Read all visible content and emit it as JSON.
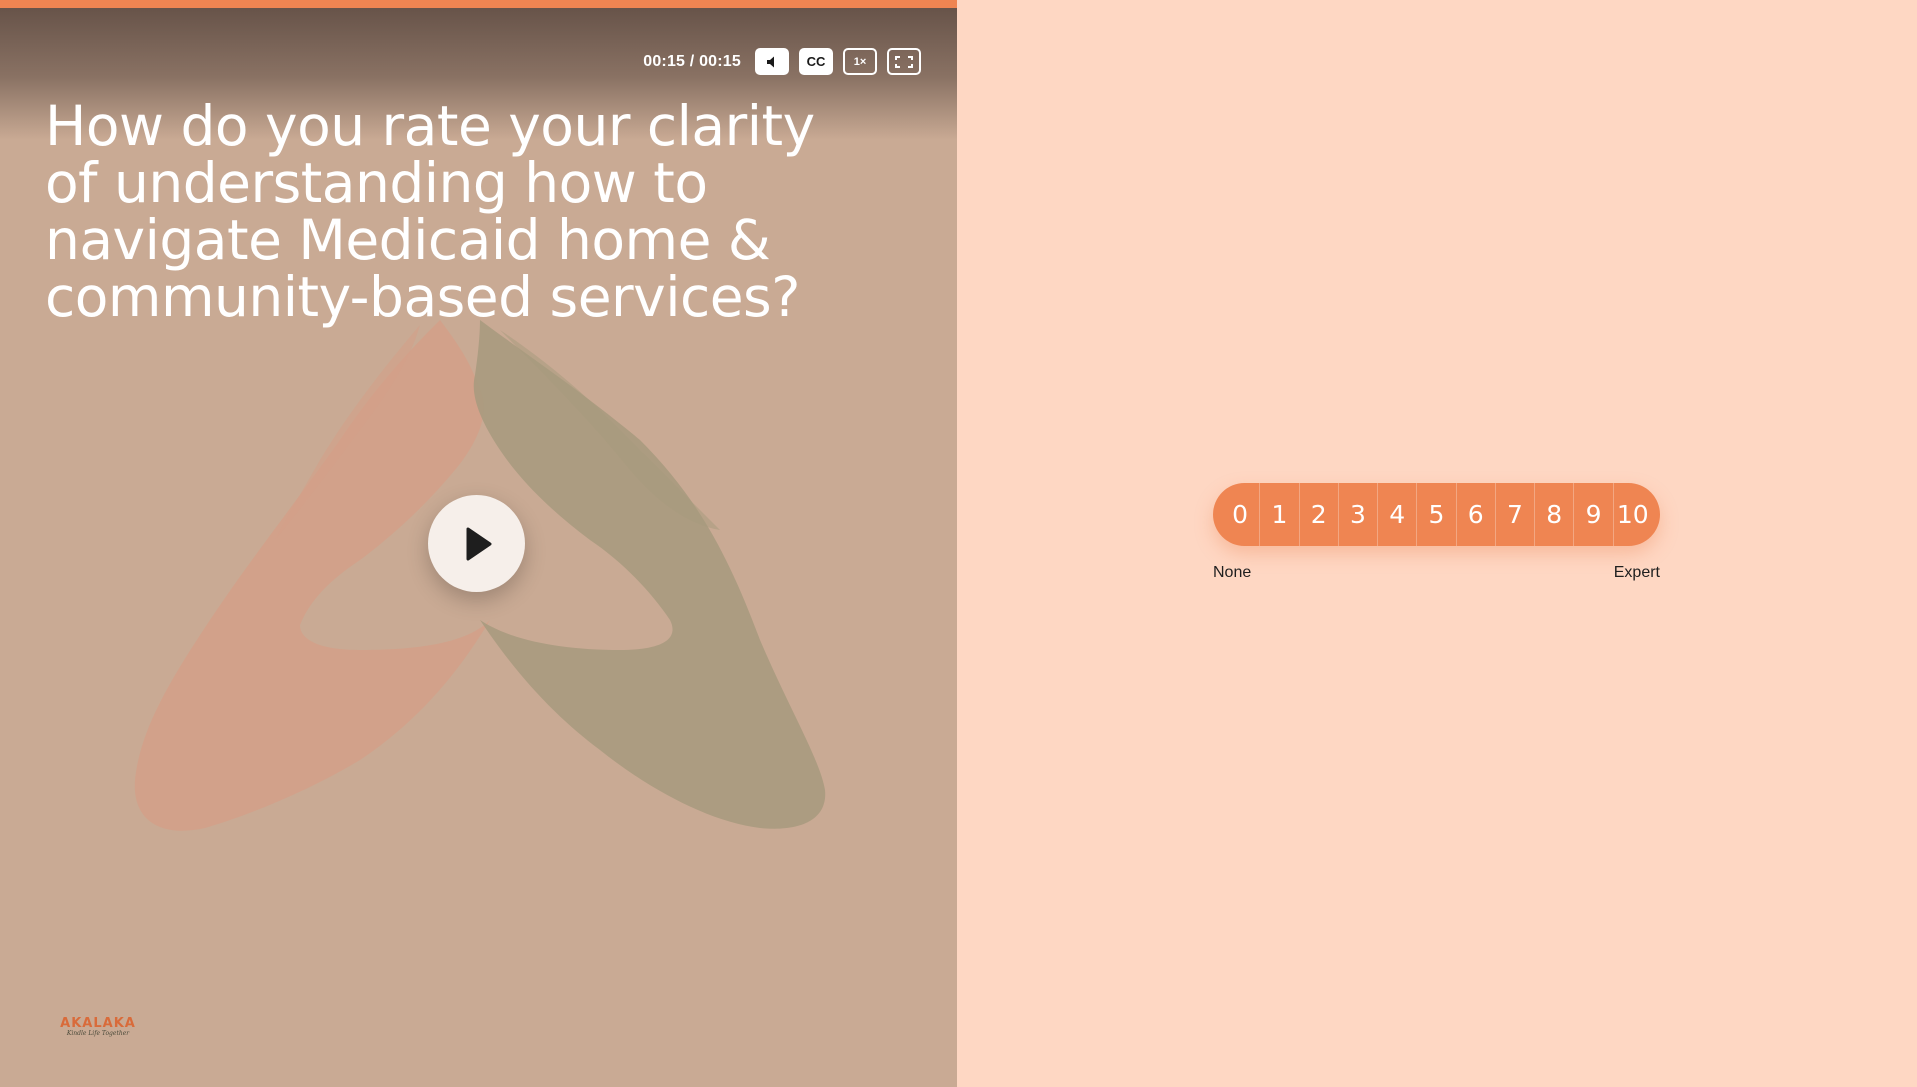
{
  "video": {
    "progress_percent": 100,
    "time_display": "00:15 / 00:15",
    "controls": {
      "mute_icon": "speaker-icon",
      "captions_label": "CC",
      "speed_label": "1×",
      "fullscreen_icon": "fullscreen-icon"
    },
    "question": "How do you rate your clarity of understanding how to navigate Medicaid home & community-based services?",
    "play_icon": "play-icon",
    "logo": {
      "name": "AKALAKA",
      "tagline": "Kindle Life Together"
    }
  },
  "rating": {
    "options": [
      "0",
      "1",
      "2",
      "3",
      "4",
      "5",
      "6",
      "7",
      "8",
      "9",
      "10"
    ],
    "min_label": "None",
    "max_label": "Expert"
  },
  "colors": {
    "accent": "#EF8552",
    "right_background": "#FED7C3",
    "video_background": "#C9AA94",
    "left_hand": "#D4A088",
    "right_hand": "#A89A7E"
  }
}
